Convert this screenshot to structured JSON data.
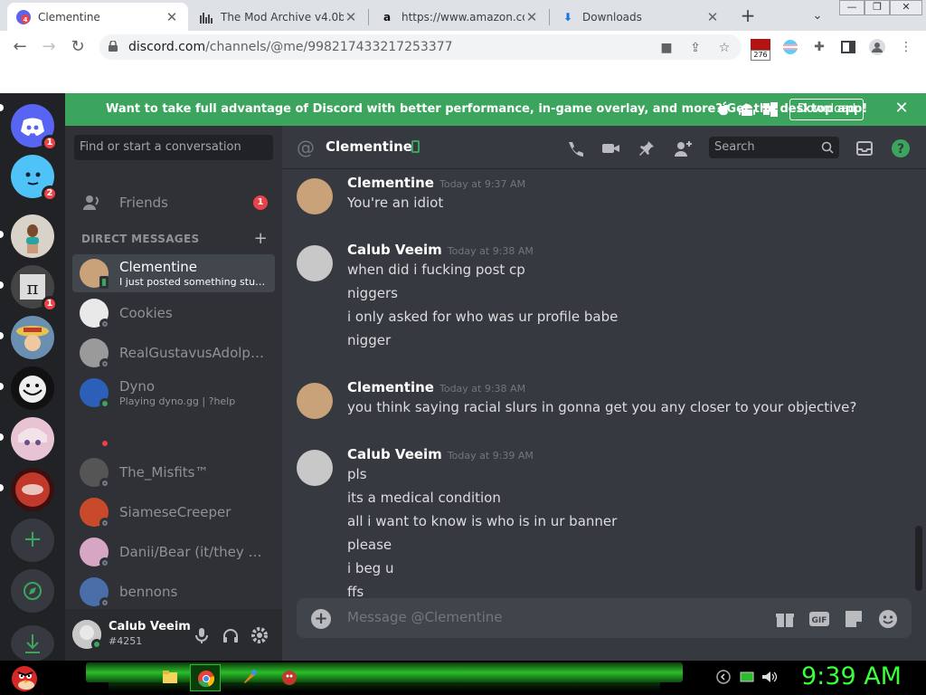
{
  "browser": {
    "tabs": [
      {
        "title": "Clementine",
        "icon": "discord-unread-icon"
      },
      {
        "title": "The Mod Archive v4.0b -",
        "icon": "mod-archive-icon"
      },
      {
        "title": "https://www.amazon.com",
        "icon": "amazon-icon"
      },
      {
        "title": "Downloads",
        "icon": "download-icon"
      }
    ],
    "active_tab": 0,
    "url_host": "discord.com",
    "url_path": "/channels/@me/998217433217253377",
    "extension_badge": "276"
  },
  "banner": {
    "text": "Want to take full advantage of Discord with better performance, in-game overlay, and more? Get the desktop app!",
    "download_label": "Download"
  },
  "guilds": [
    {
      "name": "discord-home",
      "badge": "1",
      "color": "#5865f2"
    },
    {
      "name": "blue-face-server",
      "badge": "2",
      "color": "#4fc3f7"
    },
    {
      "name": "figure-server",
      "badge": "",
      "color": "#c9b7a7"
    },
    {
      "name": "bw-server",
      "badge": "1",
      "color": "#555555"
    },
    {
      "name": "straw-hat-server",
      "badge": "",
      "color": "#d8a33a"
    },
    {
      "name": "troll-server",
      "badge": "",
      "color": "#dddddd"
    },
    {
      "name": "anime-server",
      "badge": "",
      "color": "#e7c3d3"
    },
    {
      "name": "red-server",
      "badge": "",
      "color": "#c0392b"
    }
  ],
  "sidebar": {
    "search_placeholder": "Find or start a conversation",
    "friends_label": "Friends",
    "friends_badge": "1",
    "dm_header": "DIRECT MESSAGES",
    "dms": [
      {
        "name": "Clementine",
        "sub": "I just posted something stupid ...",
        "status": "mobile",
        "color": "#c9a27a"
      },
      {
        "name": "Cookies",
        "sub": "",
        "status": "offline",
        "color": "#e9e9e9"
      },
      {
        "name": "RealGustavusAdolphus",
        "sub": "",
        "status": "offline",
        "color": "#9a9a9a"
      },
      {
        "name": "Dyno",
        "sub": "Playing dyno.gg | ?help",
        "status": "online",
        "color": "#2b5fb8"
      },
      {
        "name": "",
        "sub": "",
        "status": "dnd",
        "color": "#2f3136"
      },
      {
        "name": "The_Misfits™",
        "sub": "",
        "status": "offline",
        "color": "#555555"
      },
      {
        "name": "SiameseCreeper",
        "sub": "",
        "status": "offline",
        "color": "#c94a2a"
      },
      {
        "name": "Danii/Bear (it/they + ...",
        "sub": "",
        "status": "offline",
        "color": "#d7a6c4"
      },
      {
        "name": "bennons",
        "sub": "",
        "status": "offline",
        "color": "#4a6ea8"
      }
    ]
  },
  "user": {
    "name": "Calub Veeim",
    "tag": "#4251"
  },
  "chat": {
    "title": "Clementine",
    "search_placeholder": "Search",
    "composer_placeholder": "Message @Clementine",
    "messages": [
      {
        "author": "Clementine",
        "time": "Today at 9:37 AM",
        "lines": [
          "You're an idiot"
        ]
      },
      {
        "author": "Calub Veeim",
        "time": "Today at 9:38 AM",
        "lines": [
          "when did i fucking post cp",
          "niggers",
          "i only asked for who was ur profile babe",
          "nigger"
        ]
      },
      {
        "author": "Clementine",
        "time": "Today at 9:38 AM",
        "lines": [
          "you think saying racial slurs in gonna get you any closer to your objective?"
        ]
      },
      {
        "author": "Calub Veeim",
        "time": "Today at 9:39 AM",
        "lines": [
          "pls",
          "its a medical condition",
          "all i want to know is who is in ur banner",
          "please",
          "i beg u",
          "ffs"
        ]
      }
    ]
  },
  "taskbar": {
    "clock": "9:39 AM"
  }
}
